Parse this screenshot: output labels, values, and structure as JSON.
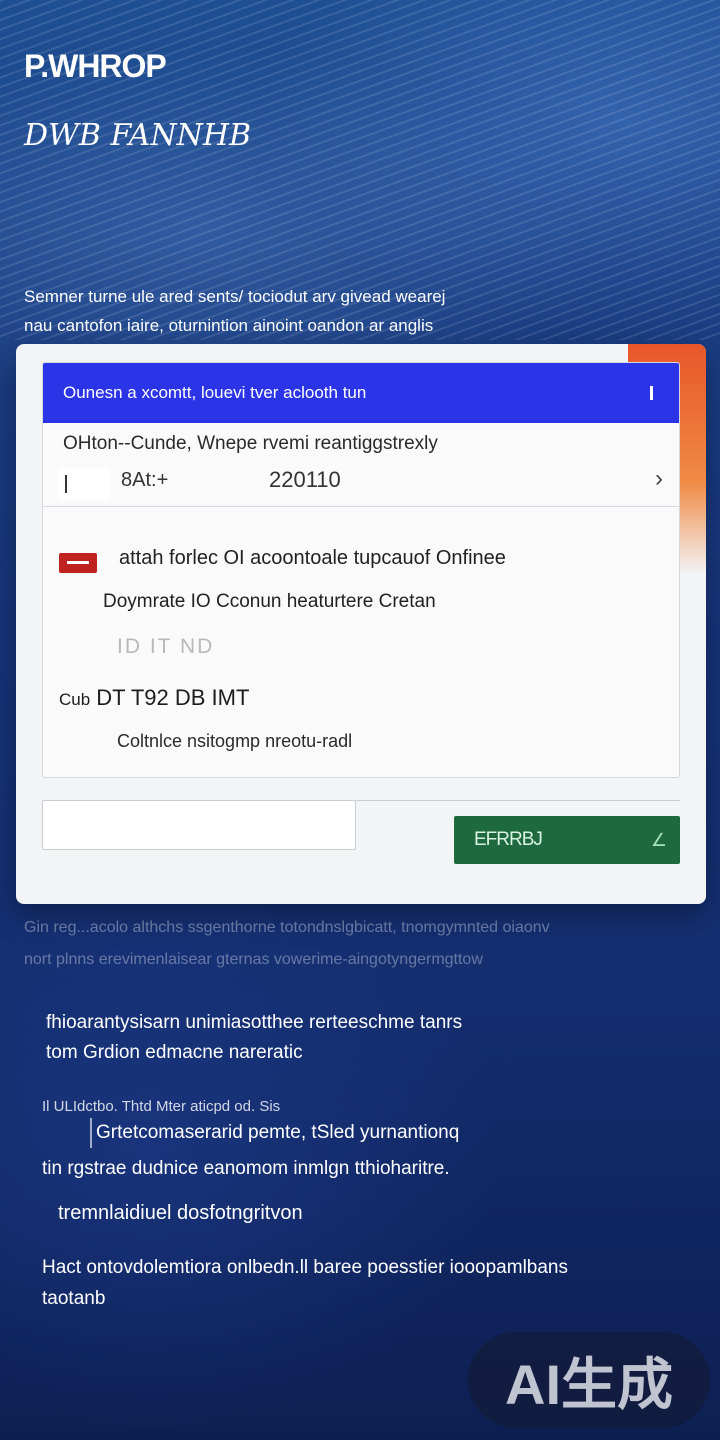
{
  "header": {
    "brand": "P.WHROP",
    "subtitle": "DWB FANNHB"
  },
  "intro": {
    "line1": "Semner turne ule ared sents/ tociodut arv givead wearej",
    "line2": "nau cantofon iaire, oturnintion ainoint oandon ar anglis"
  },
  "card": {
    "banner_text": "Ounesn a xcomtt, louevi tver aclooth tun",
    "row_title": "OHton--Cunde, Wnepe rvemi reantiggstrexly",
    "field_code": "8At:+",
    "field_year": "220110",
    "line1": "attah forlec OI acoontoale tupcauof Onfinee",
    "line2": "Doymrate IO Cconun heaturtere Cretan",
    "line3": "ID IT ND",
    "line4_prefix": "Cub",
    "line4": "DT T92 DB IMT",
    "line5": "Coltnlce nsitogmp nreotu-radl",
    "input_placeholder": "",
    "submit_label": "EFRRBJ",
    "submit_corner": "∠"
  },
  "ghost": {
    "line1": "Gin reg...acolo althchs ssgenthorne totondnslgbicatt, tnomgymnted oiaonv",
    "line2": "nort plnns erevimenlaisear gternas vowerime-aingotyngermgttow"
  },
  "body": {
    "p1_line1": "fhioarantysisarn unimiasotthee rerteeschme tanrs",
    "p1_line2": "tom Grdion edmacne nareratic",
    "p2": "Il ULIdctbo. Thtd Mter aticpd od. Sis",
    "p3": "Grtetcomaserarid pemte, tSled yurnantionq",
    "p4": "tin rgstrae dudnice eanomom inmlgn tthioharitre.",
    "p5": "tremnlaidiuel dosfotngritvon",
    "p6_line1": "Hact ontovdolemtiora onlbedn.ll baree poesstier iooopamlbans",
    "p6_line2": "taotanb"
  },
  "watermark": {
    "text": "AI生成"
  },
  "colors": {
    "banner": "#2b34e6",
    "submit": "#1e6a3e",
    "accent_edge": "#e8562a",
    "flag": "#c0231f"
  }
}
